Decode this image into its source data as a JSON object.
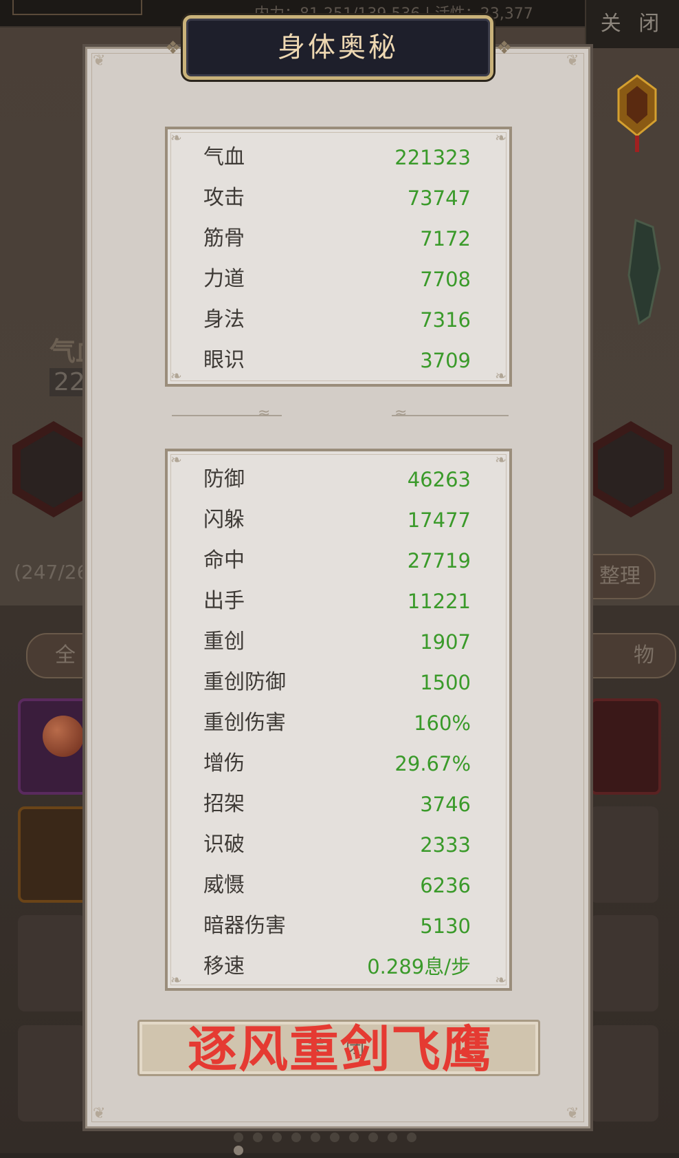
{
  "topbar": {
    "stats_text": "内力：81,251/139,536  |  活性：23,377",
    "close_label": "关 闭"
  },
  "background": {
    "qi_label": "气血",
    "qi_value": "221",
    "bag_count": "(247/26",
    "sort_label": "整理",
    "filter_all_label": "全",
    "filter_items_label": "物"
  },
  "modal": {
    "title": "身体奥秘",
    "action_button_label": "关 闭",
    "watermark_text": "逐风重剑飞鹰"
  },
  "primary_stats": [
    {
      "label": "气血",
      "value": "221323"
    },
    {
      "label": "攻击",
      "value": "73747"
    },
    {
      "label": "筋骨",
      "value": "7172"
    },
    {
      "label": "力道",
      "value": "7708"
    },
    {
      "label": "身法",
      "value": "7316"
    },
    {
      "label": "眼识",
      "value": "3709"
    }
  ],
  "secondary_stats": [
    {
      "label": "防御",
      "value": "46263"
    },
    {
      "label": "闪躲",
      "value": "17477"
    },
    {
      "label": "命中",
      "value": "27719"
    },
    {
      "label": "出手",
      "value": "11221"
    },
    {
      "label": "重创",
      "value": "1907"
    },
    {
      "label": "重创防御",
      "value": "1500"
    },
    {
      "label": "重创伤害",
      "value": "160%"
    },
    {
      "label": "增伤",
      "value": "29.67%"
    },
    {
      "label": "招架",
      "value": "3746"
    },
    {
      "label": "识破",
      "value": "2333"
    },
    {
      "label": "威慑",
      "value": "6236"
    },
    {
      "label": "暗器伤害",
      "value": "5130"
    },
    {
      "label": "移速",
      "value": "0.289息/步"
    }
  ],
  "colors": {
    "stat_value": "#3a9a2a",
    "title_text": "#eed8b2",
    "watermark": "#e53a32"
  }
}
